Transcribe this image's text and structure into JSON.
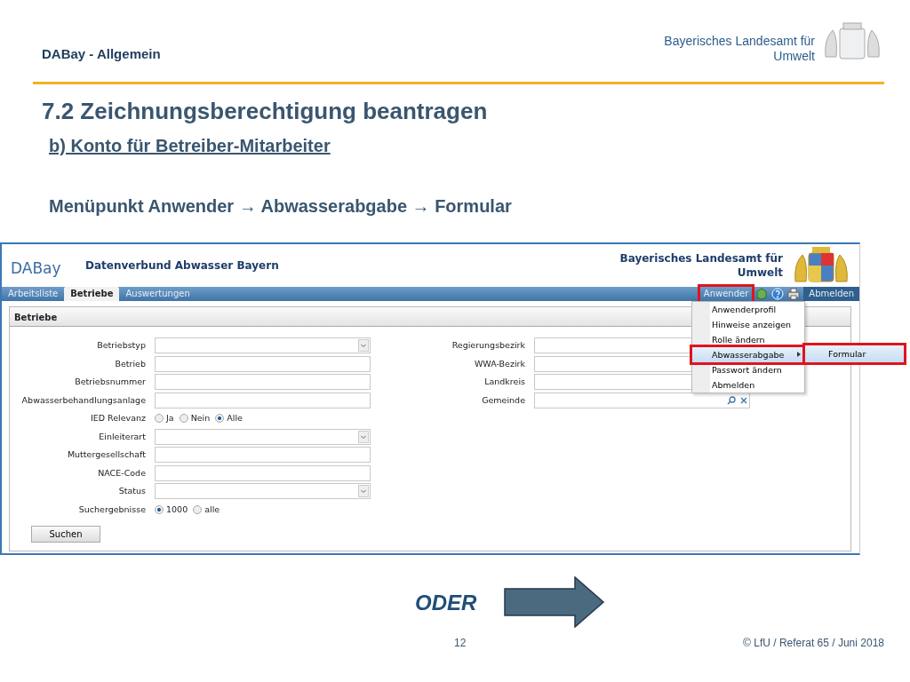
{
  "slide": {
    "section": "DABay - Allgemein",
    "org_lines": [
      "Bayerisches Landesamt für",
      "Umwelt"
    ],
    "title": "7.2 Zeichnungsberechtigung beantragen",
    "subtitle": "b) Konto für Betreiber-Mitarbeiter",
    "instruction": "Menüpunkt Anwender → Abwasserabgabe → Formular"
  },
  "app": {
    "logo_text": "DABay",
    "title": "Datenverbund Abwasser Bayern",
    "org_lines": [
      "Bayerisches Landesamt für",
      "Umwelt"
    ],
    "tabs": [
      {
        "label": "Arbeitsliste",
        "selected": false
      },
      {
        "label": "Betriebe",
        "selected": true
      },
      {
        "label": "Auswertungen",
        "selected": false
      }
    ],
    "user_menu": {
      "label": "Anwender",
      "highlighted": true
    },
    "logout": "Abmelden",
    "menu_items": [
      {
        "label": "Anwenderprofil",
        "selected": false,
        "highlighted": false,
        "has_submenu": false
      },
      {
        "label": "Hinweise anzeigen",
        "selected": false,
        "highlighted": false,
        "has_submenu": false
      },
      {
        "label": "Rolle ändern",
        "selected": false,
        "highlighted": false,
        "has_submenu": false
      },
      {
        "label": "Abwasserabgabe",
        "selected": true,
        "highlighted": true,
        "has_submenu": true
      },
      {
        "label": "Passwort ändern",
        "selected": false,
        "highlighted": false,
        "has_submenu": false
      },
      {
        "label": "Abmelden",
        "selected": false,
        "highlighted": false,
        "has_submenu": false
      }
    ],
    "submenu": [
      {
        "label": "Formular",
        "selected": true,
        "highlighted": true
      }
    ],
    "panel_title": "Betriebe",
    "left_fields": [
      {
        "label": "Betriebstyp",
        "kind": "select"
      },
      {
        "label": "Betrieb",
        "kind": "text"
      },
      {
        "label": "Betriebsnummer",
        "kind": "text"
      },
      {
        "label": "Abwasserbehandlungsanlage",
        "kind": "text"
      },
      {
        "label": "IED Relevanz",
        "kind": "radio",
        "options": [
          {
            "label": "Ja",
            "selected": false
          },
          {
            "label": "Nein",
            "selected": false
          },
          {
            "label": "Alle",
            "selected": true
          }
        ]
      },
      {
        "label": "Einleiterart",
        "kind": "select"
      },
      {
        "label": "Muttergesellschaft",
        "kind": "text"
      },
      {
        "label": "NACE-Code",
        "kind": "text"
      },
      {
        "label": "Status",
        "kind": "select"
      },
      {
        "label": "Suchergebnisse",
        "kind": "radio",
        "options": [
          {
            "label": "1000",
            "selected": true
          },
          {
            "label": "alle",
            "selected": false
          }
        ]
      }
    ],
    "right_fields": [
      {
        "label": "Regierungsbezirk",
        "kind": "text"
      },
      {
        "label": "WWA-Bezirk",
        "kind": "text"
      },
      {
        "label": "Landkreis",
        "kind": "text"
      },
      {
        "label": "Gemeinde",
        "kind": "lookup"
      }
    ],
    "search_button": "Suchen"
  },
  "footer": {
    "callout": "ODER",
    "page": "12",
    "copyright": "© LfU / Referat 65 / Juni 2018"
  }
}
